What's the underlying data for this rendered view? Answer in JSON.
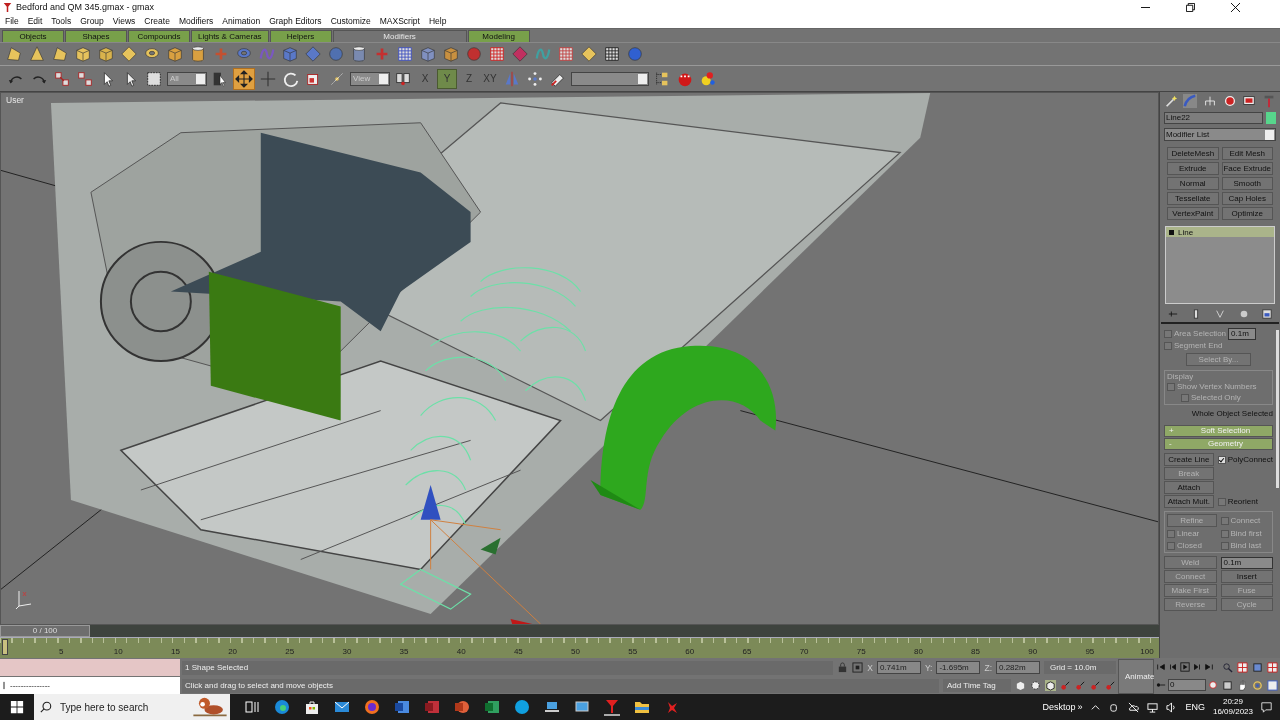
{
  "window": {
    "title": "Bedford and QM 345.gmax - gmax"
  },
  "menu": [
    "File",
    "Edit",
    "Tools",
    "Group",
    "Views",
    "Create",
    "Modifiers",
    "Animation",
    "Graph Editors",
    "Customize",
    "MAXScript",
    "Help"
  ],
  "tabs": [
    {
      "label": "Objects",
      "selected": false
    },
    {
      "label": "Shapes",
      "selected": false
    },
    {
      "label": "Compounds",
      "selected": false
    },
    {
      "label": "Lights & Cameras",
      "selected": false
    },
    {
      "label": "Helpers",
      "selected": false
    },
    {
      "label": "Modifiers",
      "selected": true
    },
    {
      "label": "Modeling",
      "selected": false
    }
  ],
  "main_toolbar": {
    "selection_filter": "All",
    "reference_coordinates": "View",
    "axis_buttons": [
      {
        "label": "X",
        "selected": false
      },
      {
        "label": "Y",
        "selected": true
      },
      {
        "label": "Z",
        "selected": false
      },
      {
        "label": "XY",
        "selected": false
      }
    ]
  },
  "viewport": {
    "label": "User"
  },
  "command_panel": {
    "object_name": "Line22",
    "modifier_list": "Modifier List",
    "modifier_buttons": [
      "DeleteMesh",
      "Edit Mesh",
      "Extrude",
      "Face Extrude",
      "Normal",
      "Smooth",
      "Tessellate",
      "Cap Holes",
      "VertexPaint",
      "Optimize"
    ],
    "stack": [
      {
        "label": "Line",
        "selected": true
      }
    ],
    "selection": {
      "area_selection": {
        "label": "Area Selection",
        "checked": false,
        "value": "0.1m"
      },
      "segment_end": {
        "label": "Segment End",
        "checked": false
      },
      "select_by": "Select By...",
      "display_group": "Display",
      "show_vertex_numbers": {
        "label": "Show Vertex Numbers",
        "checked": false
      },
      "selected_only": {
        "label": "Selected Only",
        "checked": false
      },
      "status": "Whole Object Selected"
    },
    "rollouts": [
      {
        "sign": "+",
        "title": "Soft Selection"
      },
      {
        "sign": "-",
        "title": "Geometry"
      }
    ],
    "geometry": {
      "create_line": {
        "label": "Create Line",
        "disabled": false
      },
      "polyconnect": {
        "label": "PolyConnect",
        "checked": true
      },
      "break": {
        "label": "Break",
        "disabled": true
      },
      "attach": {
        "label": "Attach",
        "disabled": false
      },
      "attach_mult": {
        "label": "Attach Mult.",
        "disabled": false
      },
      "reorient": {
        "label": "Reorient",
        "checked": false
      },
      "refine": {
        "label": "Refine",
        "disabled": true
      },
      "refine_options": [
        {
          "label": "Connect",
          "checked": false
        },
        {
          "label": "Linear",
          "checked": false
        },
        {
          "label": "Bind first",
          "checked": false
        },
        {
          "label": "Closed",
          "checked": false
        },
        {
          "label": "Bind last",
          "checked": false
        }
      ],
      "weld": {
        "label": "Weld",
        "disabled": true
      },
      "weld_value": "0.1m",
      "buttons": [
        {
          "label": "Connect",
          "disabled": true
        },
        {
          "label": "Insert",
          "disabled": false
        },
        {
          "label": "Make First",
          "disabled": true
        },
        {
          "label": "Fuse",
          "disabled": true
        },
        {
          "label": "Reverse",
          "disabled": true
        },
        {
          "label": "Cycle",
          "disabled": true
        }
      ]
    }
  },
  "time_slider": {
    "label": "0 / 100",
    "level": 0
  },
  "track_bar": {
    "ticks": [
      "5",
      "10",
      "15",
      "20",
      "25",
      "30",
      "35",
      "40",
      "45",
      "50",
      "55",
      "60",
      "65",
      "70",
      "75",
      "80",
      "85",
      "90",
      "95",
      "100"
    ]
  },
  "status_bar": {
    "listener_output": "---------------",
    "selection_info": "1 Shape Selected",
    "prompt": "Click and drag to select and move objects",
    "x_label": "X",
    "x": "0.741m",
    "y_label": "Y:",
    "y": "-1.695m",
    "z_label": "Z:",
    "z": "0.282m",
    "grid": "Grid = 10.0m",
    "add_time_tag": "Add Time Tag",
    "animate": "Animate",
    "frame": "0"
  },
  "taskbar": {
    "search_placeholder": "Type here to search",
    "desktop": "Desktop",
    "chevron": "»",
    "language": "ENG",
    "time": "20:29",
    "date": "16/09/2023"
  }
}
